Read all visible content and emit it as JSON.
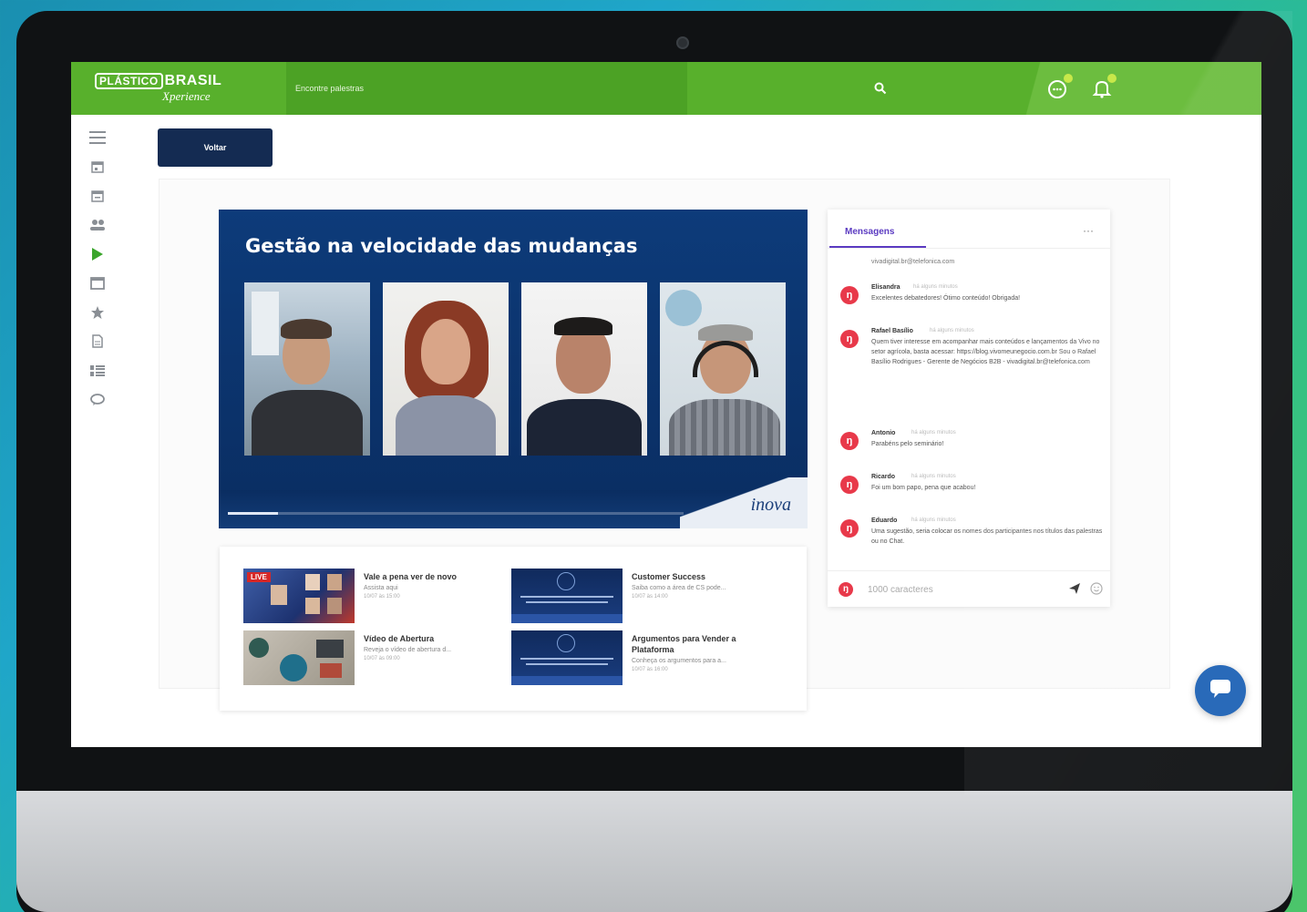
{
  "header": {
    "logo_primary": "PLÁSTICO",
    "logo_secondary": "BRASIL",
    "logo_sub": "Xperience",
    "search_placeholder": "Encontre palestras",
    "colors": {
      "bar": "#58b02c",
      "accent": "#c8e84a"
    }
  },
  "sidebar": {
    "items": [
      {
        "icon": "menu-icon"
      },
      {
        "icon": "calendar-icon"
      },
      {
        "icon": "calendar-icon"
      },
      {
        "icon": "users-icon"
      },
      {
        "icon": "play-icon",
        "active": true
      },
      {
        "icon": "window-icon"
      },
      {
        "icon": "star-icon"
      },
      {
        "icon": "document-icon"
      },
      {
        "icon": "grid-icon"
      },
      {
        "icon": "chat-icon"
      }
    ]
  },
  "back_button": "Voltar",
  "video": {
    "title": "Gestão na velocidade das mudanças",
    "brand": "inova",
    "progress": 0.11
  },
  "related": [
    {
      "title": "Vale a pena ver de novo",
      "desc": "Assista aqui",
      "date": "10/07 às 15:00",
      "badge": "LIVE"
    },
    {
      "title": "Customer Success",
      "desc": "Saiba como a área de CS pode...",
      "date": "10/07 às 14:00"
    },
    {
      "title": "Vídeo de Abertura",
      "desc": "Revejа o vídeo de abertura d...",
      "date": "10/07 às 09:00"
    },
    {
      "title": "Argumentos para Vender a Plataforma",
      "desc": "Conheça os argumentos para a...",
      "date": "10/07 às 16:00"
    }
  ],
  "chat": {
    "tab": "Mensagens",
    "more": "···",
    "first_line": "vivadigital.br@telefonica.com",
    "messages": [
      {
        "name": "Elisandra",
        "time": "há alguns minutos",
        "text": "Excelentes debatedores! Ótimo conteúdo! Obrigada!"
      },
      {
        "name": "Rafael Basílio",
        "time": "há alguns minutos",
        "text": "Quem tiver interesse em acompanhar mais conteúdos e lançamentos da Vivo no setor agrícola, basta acessar: https://blog.vivomeunegocio.com.br Sou o Rafael Basílio Rodrigues - Gerente de Negócios B2B - vivadigital.br@telefonica.com"
      },
      {
        "name": "Antonio",
        "time": "há alguns minutos",
        "text": "Parabéns pelo seminário!"
      },
      {
        "name": "Ricardo",
        "time": "há alguns minutos",
        "text": "Foi um bom papo, pena que acabou!"
      },
      {
        "name": "Eduardo",
        "time": "há alguns minutos",
        "text": "Uma sugestão, seria colocar os nomes dos participantes nos títulos das palestras ou no Chat."
      }
    ],
    "input_placeholder": "1000 caracteres"
  },
  "colors": {
    "chat_accent": "#5b3bc1",
    "avatar": "#e8394a",
    "back_button": "#142b52",
    "fab": "#1f63b6"
  }
}
